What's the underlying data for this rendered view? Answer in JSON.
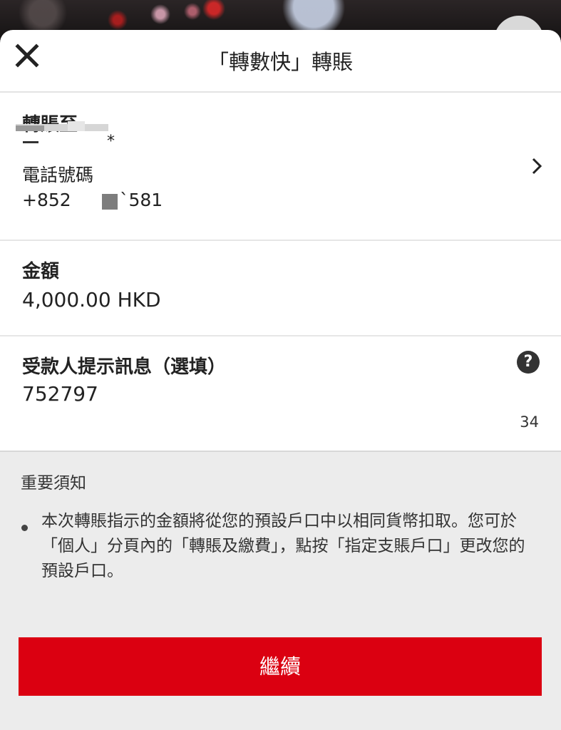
{
  "header": {
    "title": "「轉數快」轉賬",
    "close_icon": "close-icon"
  },
  "transfer_to": {
    "label": "轉賬至",
    "recipient_name_suffix": "*",
    "phone_label": "電話號碼",
    "phone_prefix": "+852",
    "phone_suffix": "`581",
    "chevron_icon": "chevron-right-icon"
  },
  "amount": {
    "label": "金額",
    "value": "4,000.00 HKD"
  },
  "message": {
    "label": "受款人提示訊息（選填）",
    "value": "752797",
    "remaining_count": "34",
    "help_icon": "?"
  },
  "notice": {
    "title": "重要須知",
    "text": "本次轉賬指示的金額將從您的預設戶口中以相同貨幣扣取。您可於「個人」分頁內的「轉賬及繳費」，點按「指定支賬戶口」更改您的預設戶口。"
  },
  "actions": {
    "continue_label": "繼續"
  },
  "colors": {
    "primary_button": "#db0011",
    "notice_background": "#ececec"
  }
}
